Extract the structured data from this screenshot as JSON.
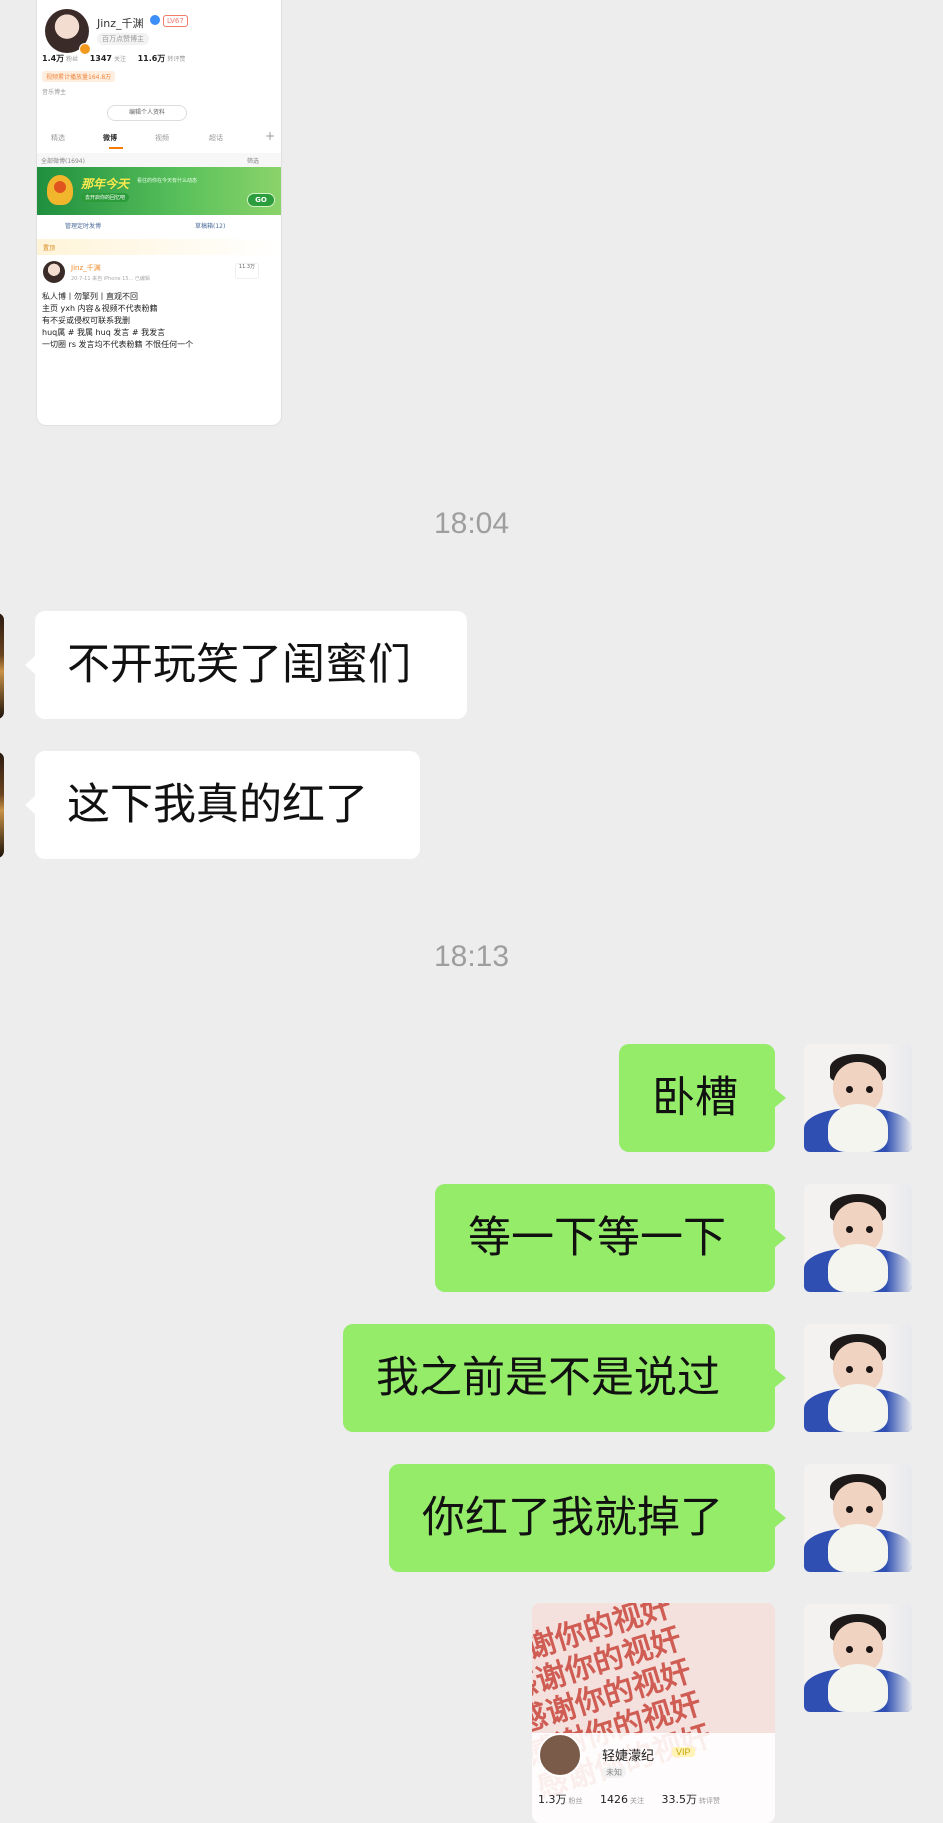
{
  "top_screenshot": {
    "username": "Jinz_千渊",
    "level_badge": "LV67",
    "sub_label": "百万点赞博主",
    "stats": [
      {
        "value": "1.4万",
        "label": "粉丝"
      },
      {
        "value": "1347",
        "label": "关注"
      },
      {
        "value": "11.6万",
        "label": "转评赞"
      }
    ],
    "play_count": "视频累计播放量164.8万",
    "tag": "音乐博主",
    "edit_button": "编辑个人资料",
    "tabs": [
      "精选",
      "微博",
      "视频",
      "超话"
    ],
    "list_header_left": "全部微博(1694)",
    "list_header_right": "筛选",
    "banner_title": "那年今天",
    "banner_sub": "看往的你在今天有什么动态",
    "banner_pill": "去开启你的回忆吧",
    "banner_go": "GO",
    "action_left": "管理定时发博",
    "action_right": "草稿箱(12)",
    "pinned": "置顶",
    "post_name": "Jinz_千渊",
    "post_meta": "20-7-11 来自 iPhone 15... 已编辑",
    "post_count": "11.3万",
    "post_lines": [
      "私人博丨勿擎列丨直观不回",
      "主页 yxh 内容＆视频不代表粉籍",
      "有不妥或侵权可联系我删",
      "huq属 # 我属 huq 发言 # 我发言",
      "一切圈 rs 发言均不代表粉籍 不恨任何一个"
    ]
  },
  "messages": {
    "time1": "18:04",
    "in1": "不开玩笑了闺蜜们",
    "in2": "这下我真的红了",
    "time2": "18:13",
    "out1": "卧槽",
    "out2": "等一下等一下",
    "out3": "我之前是不是说过",
    "out4": "你红了我就掉了"
  },
  "bottom_image": {
    "pattern_text": "感谢你的视奸",
    "name": "轻婕濛纪",
    "badge": "VIP",
    "sub": "未知",
    "stats": [
      {
        "value": "1.3万",
        "label": "粉丝"
      },
      {
        "value": "1426",
        "label": "关注"
      },
      {
        "value": "33.5万",
        "label": "转评赞"
      }
    ]
  },
  "colors": {
    "background": "#ededed",
    "bubble_in": "#ffffff",
    "bubble_out": "#95ec69",
    "timestamp": "#9e9e9e"
  }
}
